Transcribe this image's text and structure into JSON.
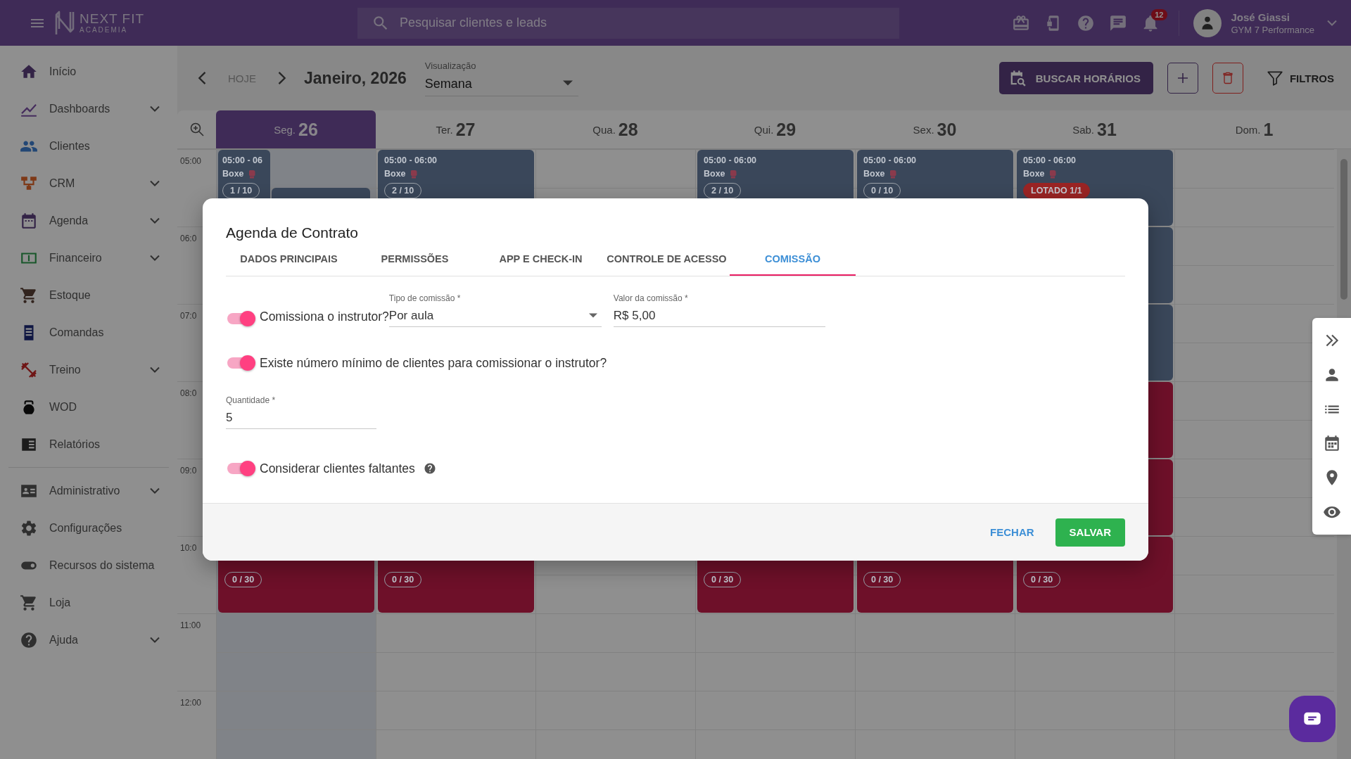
{
  "topbar": {
    "logo_name": "NEXT FIT",
    "logo_sub": "ACADEMIA",
    "search": {
      "placeholder": "Pesquisar clientes e leads"
    },
    "notifications": "12",
    "user": {
      "name": "José Giassi",
      "gym": "GYM 7 Performance"
    }
  },
  "sidebar": {
    "sections": [
      {
        "items": [
          {
            "label": "Início",
            "kind": "home",
            "expandable": false
          },
          {
            "label": "Dashboards",
            "kind": "chart",
            "expandable": true
          },
          {
            "label": "Clientes",
            "kind": "people",
            "expandable": false
          },
          {
            "label": "CRM",
            "kind": "crm",
            "expandable": true
          },
          {
            "label": "Agenda",
            "kind": "calendar",
            "expandable": true
          },
          {
            "label": "Financeiro",
            "kind": "money",
            "expandable": true
          },
          {
            "label": "Estoque",
            "kind": "cart",
            "expandable": false
          },
          {
            "label": "Comandas",
            "kind": "receipt",
            "expandable": false
          },
          {
            "label": "Treino",
            "kind": "dumbbell",
            "expandable": true
          },
          {
            "label": "WOD",
            "kind": "kettlebell",
            "expandable": false
          },
          {
            "label": "Relatórios",
            "kind": "report",
            "expandable": false
          }
        ]
      },
      {
        "items": [
          {
            "label": "Administrativo",
            "kind": "idcard",
            "expandable": true
          },
          {
            "label": "Configurações",
            "kind": "gear",
            "expandable": false
          },
          {
            "label": "Recursos do sistema",
            "kind": "toggle",
            "expandable": false
          },
          {
            "label": "Loja",
            "kind": "shop",
            "expandable": false
          },
          {
            "label": "Ajuda",
            "kind": "help",
            "expandable": true
          }
        ]
      }
    ]
  },
  "toolbar": {
    "today": "HOJE",
    "period": "Janeiro, 2026",
    "view": {
      "label": "Visualização",
      "value": "Semana"
    },
    "search_button": "BUSCAR HORÁRIOS",
    "filters": "FILTROS"
  },
  "calendar": {
    "hours": [
      "05:00",
      "06:0",
      "07:0",
      "08:0",
      "09:0",
      "10:0",
      "11:00",
      "12:00"
    ],
    "days": [
      {
        "weekday": "Seg.",
        "date": "26",
        "selected": true,
        "slots": [
          {
            "kind": "busy",
            "events": [
              {
                "kind": "narrow",
                "color": "#3a475a",
                "time": "05:00 - 06",
                "title": "Boxe",
                "badge": "1 / 10",
                "full": false
              },
              {
                "kind": "late",
                "color": "#3a475a"
              }
            ]
          },
          {
            "kind": "free"
          },
          {
            "kind": "free"
          },
          {
            "kind": "free"
          },
          {
            "kind": "free"
          },
          {
            "kind": "busy",
            "events": [
              {
                "kind": "main",
                "color": "#6e1029",
                "badge": "0 / 30",
                "full": false
              }
            ]
          }
        ]
      },
      {
        "weekday": "Ter.",
        "date": "27",
        "selected": false,
        "slots": [
          {
            "kind": "busy",
            "events": [
              {
                "kind": "main",
                "color": "#3a475a",
                "time": "05:00 - 06:00",
                "title": "Boxe",
                "badge": "2 / 10",
                "full": false
              }
            ]
          },
          {
            "kind": "free"
          },
          {
            "kind": "free"
          },
          {
            "kind": "free"
          },
          {
            "kind": "free"
          },
          {
            "kind": "busy",
            "events": [
              {
                "kind": "main",
                "color": "#6e1029",
                "badge": "0 / 30",
                "full": false
              }
            ]
          }
        ]
      },
      {
        "weekday": "Qua.",
        "date": "28",
        "selected": false
      },
      {
        "weekday": "Qui.",
        "date": "29",
        "selected": false,
        "slots": [
          {
            "kind": "busy",
            "events": [
              {
                "kind": "main",
                "color": "#3a475a",
                "time": "05:00 - 06:00",
                "title": "Boxe",
                "badge": "2 / 10",
                "full": false
              }
            ]
          },
          {
            "kind": "free"
          },
          {
            "kind": "free"
          },
          {
            "kind": "free"
          },
          {
            "kind": "free"
          },
          {
            "kind": "busy",
            "events": [
              {
                "kind": "main",
                "color": "#6e1029",
                "badge": "0 / 30",
                "full": false
              }
            ]
          }
        ]
      },
      {
        "weekday": "Sex.",
        "date": "30",
        "selected": false,
        "slots": [
          {
            "kind": "busy",
            "events": [
              {
                "kind": "main",
                "color": "#3a475a",
                "time": "05:00 - 06:00",
                "title": "Boxe",
                "badge": "0 / 10",
                "full": false
              }
            ]
          },
          {
            "kind": "free"
          },
          {
            "kind": "free"
          },
          {
            "kind": "free"
          },
          {
            "kind": "free"
          },
          {
            "kind": "busy",
            "events": [
              {
                "kind": "main",
                "color": "#6e1029",
                "badge": "0 / 30",
                "full": false
              }
            ]
          }
        ]
      },
      {
        "weekday": "Sab.",
        "date": "31",
        "selected": false,
        "slots": [
          {
            "kind": "busy",
            "events": [
              {
                "kind": "main",
                "color": "#3a475a",
                "time": "05:00 - 06:00",
                "title": "Boxe",
                "badge": "LOTADO 1/1",
                "full": true
              }
            ]
          },
          {
            "kind": "busy",
            "events": [
              {
                "kind": "main",
                "color": "#3a475a"
              }
            ]
          },
          {
            "kind": "busy",
            "events": [
              {
                "kind": "main",
                "color": "#3a475a"
              }
            ]
          },
          {
            "kind": "busy",
            "events": [
              {
                "kind": "main",
                "color": "#6e1029"
              }
            ]
          },
          {
            "kind": "busy",
            "events": [
              {
                "kind": "main",
                "color": "#6e1029"
              }
            ]
          },
          {
            "kind": "busy",
            "events": [
              {
                "kind": "main",
                "color": "#6e1029",
                "badge": "0 / 30",
                "full": false
              }
            ]
          }
        ]
      },
      {
        "weekday": "Dom.",
        "date": "1",
        "selected": false
      }
    ]
  },
  "dialog": {
    "title": "Agenda de Contrato",
    "tabs": [
      {
        "label": "DADOS PRINCIPAIS",
        "selected": false
      },
      {
        "label": "PERMISSÕES",
        "selected": false
      },
      {
        "label": "APP E CHECK-IN",
        "selected": false
      },
      {
        "label": "CONTROLE DE ACESSO",
        "selected": false
      },
      {
        "label": "COMISSÃO",
        "selected": true
      }
    ],
    "rows": [
      {
        "kind": "toggle",
        "label": "Comissiona o instrutor?",
        "on": true,
        "fields": [
          {
            "kind": "select",
            "label": "Tipo de comissão *",
            "value": "Por aula"
          },
          {
            "kind": "input",
            "label": "Valor da comissão *",
            "value": "R$ 5,00"
          }
        ]
      },
      {
        "kind": "toggle",
        "label": "Existe número mínimo de clientes para comissionar o instrutor?",
        "on": true
      },
      {
        "kind": "input",
        "label": "Quantidade *",
        "value": "5"
      },
      {
        "kind": "toggle",
        "label": "Considerar clientes faltantes",
        "on": true,
        "help": true
      }
    ],
    "buttons": {
      "close": "FECHAR",
      "save": "SALVAR"
    }
  }
}
